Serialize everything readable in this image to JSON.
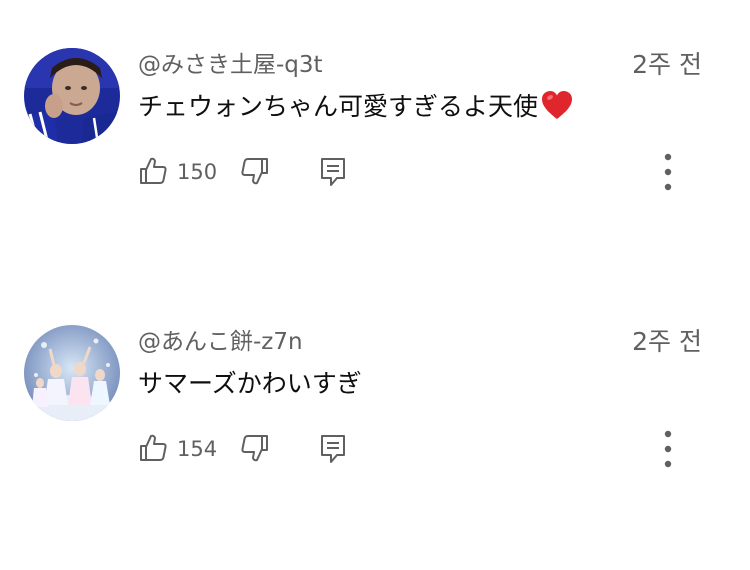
{
  "comments": [
    {
      "author": "@みさき土屋-q3t",
      "time": "2주 전",
      "text": "チェウォンちゃん可愛すぎるよ天使",
      "emoji_icon": "red-heart-icon",
      "likes": "150"
    },
    {
      "author": "@あんこ餅-z7n",
      "time": "2주 전",
      "text": "サマーズかわいすぎ",
      "likes": "154"
    }
  ],
  "colors": {
    "text_primary": "#0f0f0f",
    "text_secondary": "#606060",
    "icon": "#606060",
    "heart": "#e0262d"
  }
}
